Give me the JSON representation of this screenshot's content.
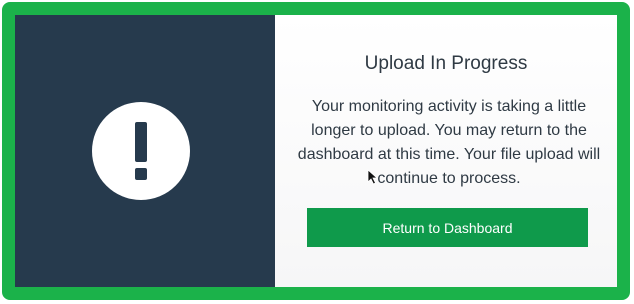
{
  "dialog": {
    "title": "Upload In Progress",
    "message": "Your monitoring activity is taking a little longer to upload. You may return to the dashboard at this time. Your file upload will continue to process.",
    "button_label": "Return to Dashboard",
    "icon": "exclamation-circle-icon"
  },
  "colors": {
    "frame_border": "#1bb24a",
    "left_panel": "#263a4d",
    "button": "#0f9a4b",
    "text": "#2f3a44"
  }
}
